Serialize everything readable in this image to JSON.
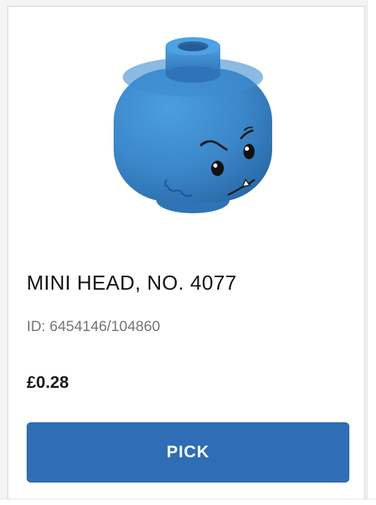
{
  "product": {
    "title": "MINI HEAD, NO. 4077",
    "id_text": "ID: 6454146/104860",
    "price": "£0.28",
    "image_icon": "minifigure-head-icon"
  },
  "actions": {
    "pick_label": "PICK"
  },
  "colors": {
    "accent": "#2f6db5",
    "head_blue": "#3a86c8"
  }
}
